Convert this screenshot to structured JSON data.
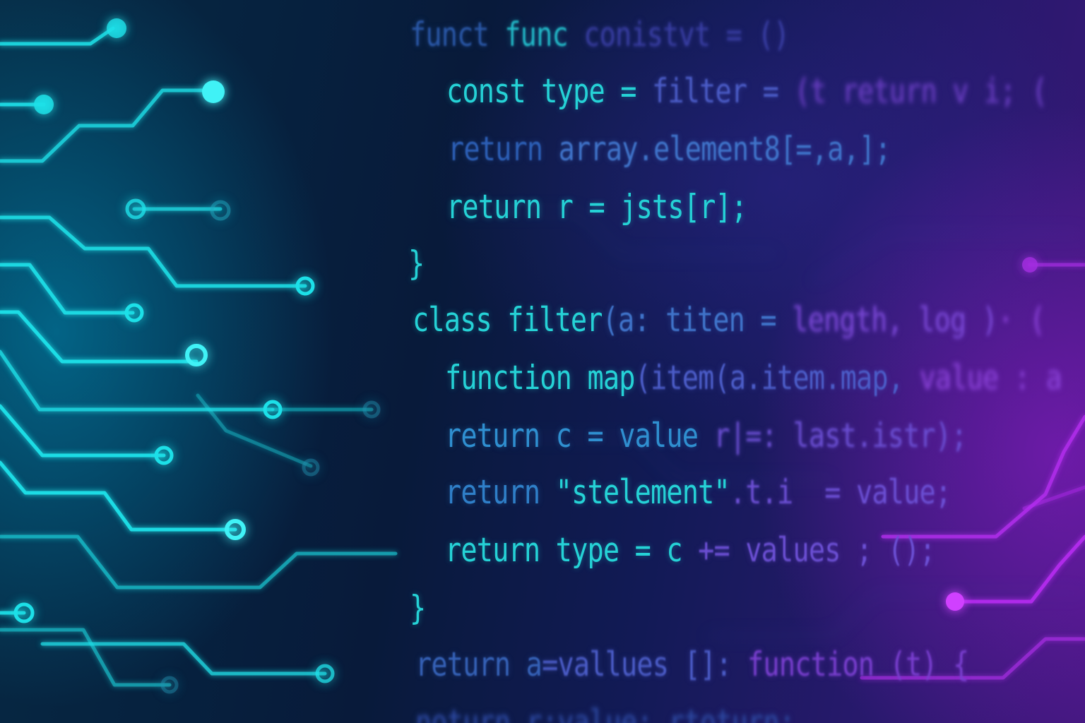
{
  "code_lines": [
    [
      {
        "text": "funct ",
        "color": "#2a58a8"
      },
      {
        "text": "func ",
        "color": "#22b9c8"
      },
      {
        "text": "conistvt = ()",
        "color": "#3a3fa6"
      }
    ],
    [
      {
        "text": "const type = ",
        "color": "#25d2d6"
      },
      {
        "text": "filter = ",
        "color": "#4b5cc7"
      },
      {
        "text": "(t return v i; (",
        "color": "#6b3fc4"
      }
    ],
    [
      {
        "text": "return ",
        "color": "#2c5fb6"
      },
      {
        "text": "array.element8[=,a,];",
        "color": "#3f73c9"
      }
    ],
    [
      {
        "text": "return r = jsts[r];",
        "color": "#25d2d6"
      }
    ],
    [
      {
        "text": "}",
        "color": "#25d2d6"
      }
    ],
    [
      {
        "text": "class filter",
        "color": "#25d2d6"
      },
      {
        "text": "(a: titen = ",
        "color": "#3f73c9"
      },
      {
        "text": "length, log )",
        "color": "#7a48d6"
      },
      {
        "text": "· (",
        "color": "#8a42d8"
      }
    ],
    [
      {
        "text": "function map",
        "color": "#25d2d6"
      },
      {
        "text": "(item(a.item.map, ",
        "color": "#4b5cc7"
      },
      {
        "text": "value : a",
        "color": "#8a42d8"
      }
    ],
    [
      {
        "text": "return c = value ",
        "color": "#2f8fd0"
      },
      {
        "text": "r|=: last.istr);",
        "color": "#6b4fd3"
      }
    ],
    [
      {
        "text": "return ",
        "color": "#2f7fc8"
      },
      {
        "text": "\"stelement\"",
        "color": "#25d2d6"
      },
      {
        "text": ".t.i  = value;",
        "color": "#6b4fd3"
      }
    ],
    [
      {
        "text": "return type = c ",
        "color": "#25d2d6"
      },
      {
        "text": "+= values ; ();",
        "color": "#6b4fd3"
      }
    ],
    [
      {
        "text": "}",
        "color": "#25d2d6"
      }
    ],
    [
      {
        "text": "return a",
        "color": "#3561b6"
      },
      {
        "text": "=vallues []: ",
        "color": "#4b5cc7"
      },
      {
        "text": "function (t) {",
        "color": "#7a3fd0"
      }
    ],
    [
      {
        "text": "noturn r:value: rtoturn:",
        "color": "#2e4aa4"
      }
    ]
  ],
  "colors": {
    "cyan_trace": "#1fe0e8",
    "purple_trace": "#b52ef0",
    "background_left": "#062a44",
    "background_right": "#3b1778"
  }
}
